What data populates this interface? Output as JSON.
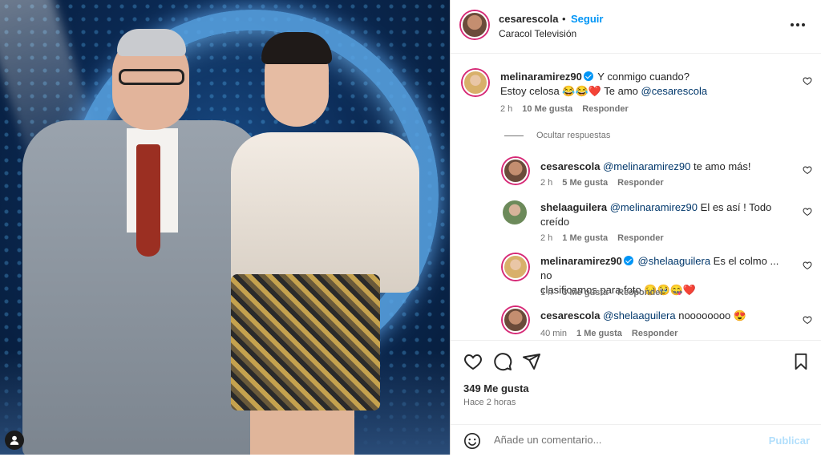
{
  "post": {
    "author": "cesarescola",
    "follow_label": "Seguir",
    "dot": "•",
    "subtitle": "Caracol Televisión"
  },
  "comments": [
    {
      "user": "melinaramirez90",
      "verified": true,
      "text": "Y conmigo cuando?",
      "text2": "Estoy celosa 😂😂❤️ Te amo ",
      "mention": "@cesarescola",
      "time": "2 h",
      "likes": "10 Me gusta",
      "reply": "Responder",
      "avatar": "blonde"
    }
  ],
  "hide_replies_label": "Ocultar respuestas",
  "replies": [
    {
      "user": "cesarescola",
      "mention": "@melinaramirez90",
      "text": " te amo más!",
      "time": "2 h",
      "likes": "5 Me gusta",
      "reply": "Responder",
      "avatar": "brown"
    },
    {
      "user": "shelaaguilera",
      "mention": "@melinaramirez90",
      "text": " El es así ! Todo",
      "text2": "creído",
      "time": "2 h",
      "likes": "1 Me gusta",
      "reply": "Responder",
      "avatar": "plain"
    },
    {
      "user": "melinaramirez90",
      "verified": true,
      "mention": "@shelaaguilera",
      "text": " Es el colmo ... no",
      "text2": "clasificamos para foto 😔🥹😋❤️",
      "time": "1 h",
      "likes": "3 Me gusta",
      "reply": "Responder",
      "avatar": "blonde"
    },
    {
      "user": "cesarescola",
      "mention": "@shelaaguilera",
      "text": " noooooooo 😍",
      "time": "40 min",
      "likes": "1 Me gusta",
      "reply": "Responder",
      "avatar": "brown"
    }
  ],
  "more_replies": "•••",
  "likes_count": "349 Me gusta",
  "posted_time": "Hace 2 horas",
  "comment_placeholder": "Añade un comentario...",
  "publish_label": "Publicar"
}
